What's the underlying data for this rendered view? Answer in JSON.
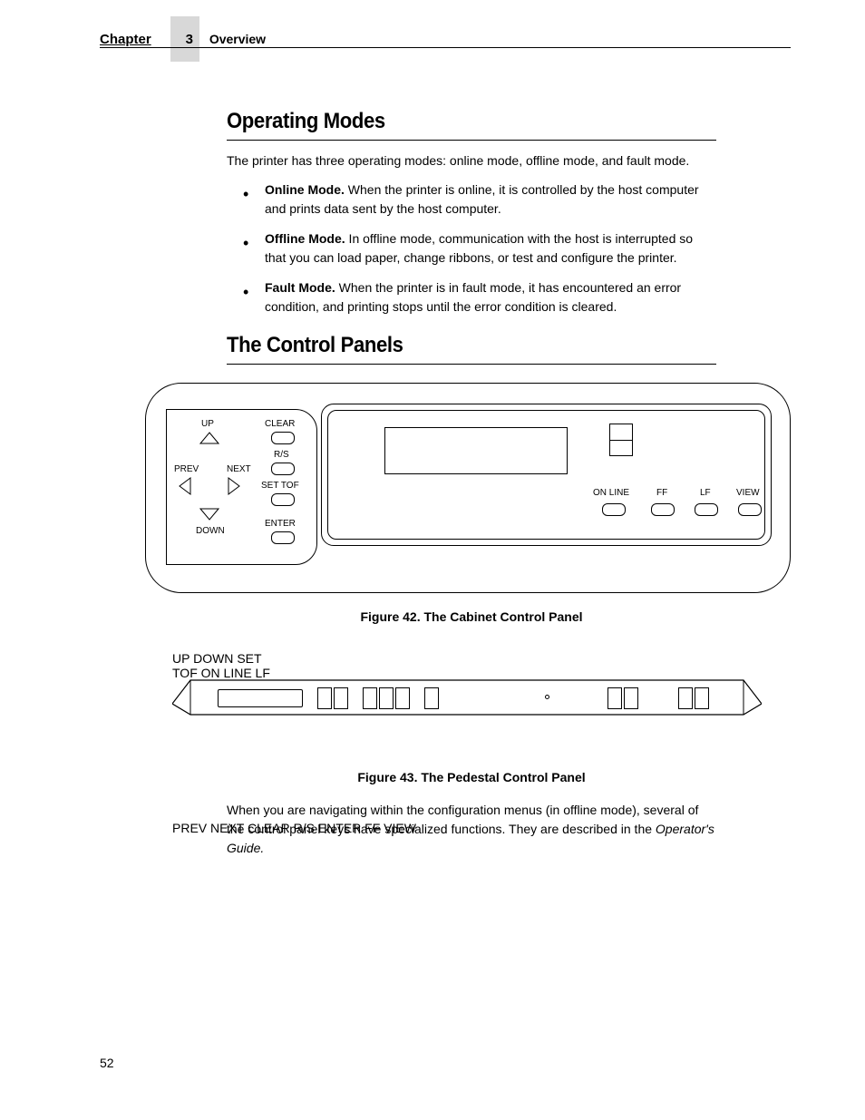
{
  "header": {
    "chapter_label": "Chapter",
    "chapter_number": "3",
    "section": "Overview"
  },
  "s1": {
    "heading": "Operating Modes",
    "intro": "The printer has three operating modes: online mode, offline mode, and fault mode.",
    "b1_head": "Online Mode.",
    "b1_body": " When the printer is online, it is controlled by the host computer and prints data sent by the host computer.",
    "b2_head": "Offline Mode.",
    "b2_body": " In offline mode, communication with the host is interrupted so that you can load paper, change ribbons, or test and configure the printer.",
    "b3_head": "Fault Mode.",
    "b3_body": " When the printer is in fault mode, it has encountered an error condition, and printing stops until the error condition is cleared."
  },
  "s2": {
    "heading": "The Control Panels"
  },
  "fig42": {
    "caption": "Figure 42. The Cabinet Control Panel",
    "up": "UP",
    "down": "DOWN",
    "prev": "PREV",
    "next": "NEXT",
    "clear": "CLEAR",
    "rs": "R/S",
    "settof": "SET TOF",
    "enter": "ENTER",
    "online": "ON LINE",
    "ff": "FF",
    "lf": "LF",
    "view": "VIEW"
  },
  "fig43": {
    "caption": "Figure 43. The Pedestal Control Panel",
    "up": "UP",
    "down": "DOWN",
    "settof": "SET\nTOF",
    "prev": "PREV",
    "next": "NEXT",
    "clear": "CLEAR",
    "rs": "R/S",
    "enter": "ENTER",
    "online": "ON LINE",
    "lf": "LF",
    "ff": "FF",
    "view": "VIEW"
  },
  "closing_a": "When you are navigating within the configuration menus (in offline mode), several of the control panel keys have specialized functions. They are described in the ",
  "closing_b": "Operator's Guide.",
  "page_number": "52"
}
